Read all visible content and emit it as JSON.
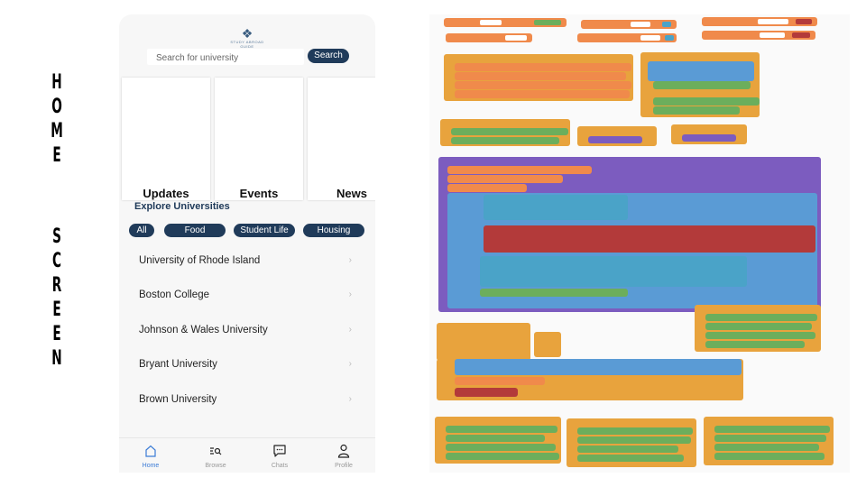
{
  "side_title": {
    "word1": [
      "H",
      "O",
      "M",
      "E"
    ],
    "word2": [
      "S",
      "C",
      "R",
      "E",
      "E",
      "N"
    ]
  },
  "app": {
    "logo_text": "STUDY ABROAD GUIDE",
    "search": {
      "placeholder": "Search for university",
      "button_label": "Search"
    },
    "cards": [
      {
        "label": "Updates"
      },
      {
        "label": "Events"
      },
      {
        "label": "News"
      }
    ],
    "explore_title": "Explore Universities",
    "chips": [
      "All",
      "Food",
      "Student Life",
      "Housing"
    ],
    "universities": [
      "University of Rhode Island",
      "Boston College",
      "Johnson & Wales University",
      "Bryant University",
      "Brown University"
    ],
    "chevron": "›",
    "tabs": [
      {
        "label": "Home",
        "icon": "home-icon"
      },
      {
        "label": "Browse",
        "icon": "browse-icon"
      },
      {
        "label": "Chats",
        "icon": "chat-icon"
      },
      {
        "label": "Profile",
        "icon": "profile-icon"
      }
    ],
    "colors": {
      "primary": "#203b5a",
      "active_tab": "#3b7bd6"
    }
  },
  "blocks": {
    "colors": {
      "variable": "#f08a4b",
      "control": "#e8a33d",
      "component": "#6cae5c",
      "text": "#b33a3a",
      "logic": "#5a9bd5",
      "procedure": "#7c5cbf",
      "list": "#4aa3c8"
    }
  }
}
